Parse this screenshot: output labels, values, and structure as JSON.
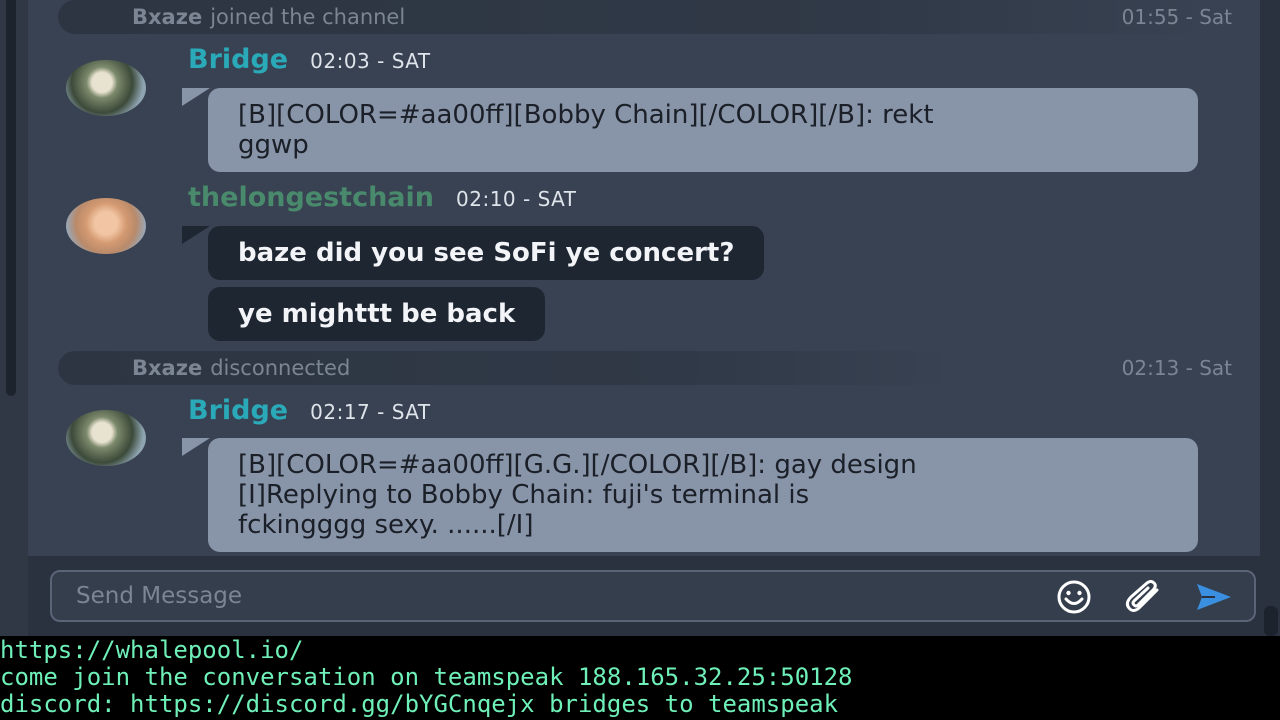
{
  "chat": {
    "events": [
      {
        "user": "Bxaze",
        "text": "joined the channel",
        "time": "01:55 - Sat"
      },
      {
        "user": "Bxaze",
        "text": "disconnected",
        "time": "02:13 - Sat"
      }
    ],
    "messages": [
      {
        "user": "Bridge",
        "time": "02:03 - SAT",
        "lines": [
          "[B][COLOR=#aa00ff][Bobby Chain][/COLOR][/B]: rekt",
          "ggwp"
        ]
      },
      {
        "user": "thelongestchain",
        "time": "02:10 - SAT",
        "bubbles": [
          "baze did you see SoFi ye concert?",
          "ye mighttt be back"
        ]
      },
      {
        "user": "Bridge",
        "time": "02:17 - SAT",
        "lines": [
          "[B][COLOR=#aa00ff][G.G.][/COLOR][/B]: gay design",
          "[I]Replying to Bobby Chain: fuji's terminal is",
          "fckingggg sexy. ......[/I]"
        ]
      }
    ]
  },
  "composer": {
    "placeholder": "Send Message",
    "icons": [
      "emoji-icon",
      "paperclip-icon",
      "send-icon"
    ]
  },
  "terminal": {
    "lines": [
      "https://whalepool.io/",
      "come join the conversation on teamspeak 188.165.32.25:50128",
      "discord: https://discord.gg/bYGCnqejx bridges to teamspeak"
    ]
  },
  "colors": {
    "bridge_user": "#2aaab8",
    "chain_user": "#4a8a6c",
    "terminal_text": "#6ef0b8",
    "send_icon": "#3a8fe0"
  }
}
